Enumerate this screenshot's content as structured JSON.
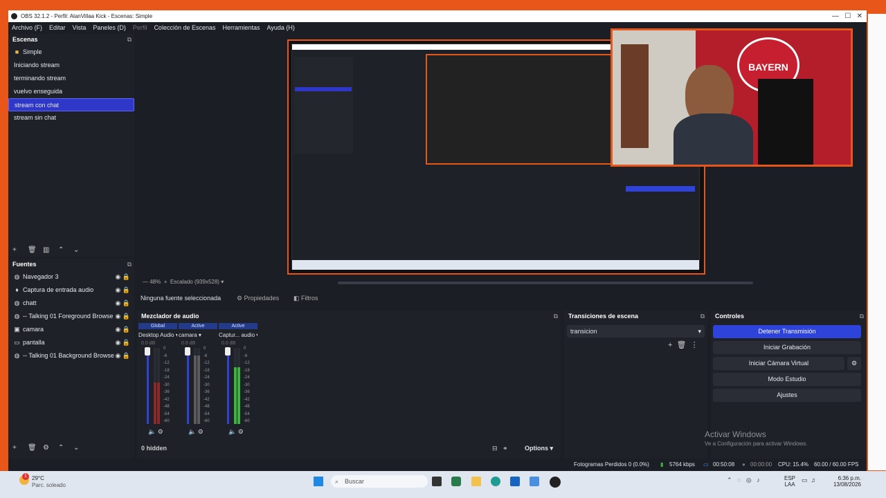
{
  "window": {
    "title": "OBS 32.1.2 - Perfil: AlanVillaa Kick - Escenas: Simple"
  },
  "menu": [
    "Archivo (F)",
    "Editar",
    "Vista",
    "Paneles (D)",
    "Perfil",
    "Colección de Escenas",
    "Herramientas",
    "Ayuda (H)"
  ],
  "scenes": {
    "title": "Escenas",
    "items": [
      "Simple",
      "Iniciando stream",
      "terminando stream",
      "vuelvo enseguida",
      "stream con chat",
      "stream sin chat"
    ]
  },
  "sources": {
    "title": "Fuentes",
    "items": [
      "Navegador 3",
      "Captura de entrada audio",
      "chatt",
      "-- Talking 01  Foreground Browse",
      "camara",
      "pantalla",
      "-- Talking 01  Background Browse"
    ]
  },
  "preview": {
    "zoom": "48%",
    "scaled": "Escalado (939x528)",
    "webcam_text": "BAYERN"
  },
  "source_toolbar": {
    "none": "Ninguna fuente seleccionada",
    "props": "Propiedades",
    "filters": "Filtros"
  },
  "mixer": {
    "title": "Mezclador de audio",
    "channels": [
      {
        "badge": "Global",
        "name": "Desktop Audio",
        "db": "0.0 dB",
        "level": 0.55,
        "color": "#8a2a2a"
      },
      {
        "badge": "Active",
        "name": "camara",
        "db": "0.0 dB",
        "level": 0.9,
        "color": "#5c5c5c"
      },
      {
        "badge": "Active",
        "name": "Captur... audio",
        "db": "0.0 dB",
        "level": 0.75,
        "color": "#3fb33f"
      }
    ],
    "scale": [
      "0",
      "-6",
      "-12",
      "-18",
      "-24",
      "-30",
      "-36",
      "-42",
      "-48",
      "-54",
      "-60"
    ],
    "hidden": "0 hidden",
    "options": "Options"
  },
  "transitions": {
    "title": "Transiciones de escena",
    "selected": "transicion"
  },
  "controls": {
    "title": "Controles",
    "stream": "Detener Transmisión",
    "record": "Iniciar Grabación",
    "virtualcam": "Iniciar Cámara Virtual",
    "studio": "Modo Estudio",
    "settings": "Ajustes"
  },
  "activate": {
    "line1": "Activar Windows",
    "line2": "Ve a Configuración para activar Windows."
  },
  "statusbar": {
    "dropped": "Fotogramas Perdidos 0 (0.0%)",
    "kbps": "5764 kbps",
    "stream_time": "00:50:08",
    "rec_time": "00:00:00",
    "cpu": "CPU: 15.4%",
    "fps": "60.00 / 60.00 FPS"
  },
  "taskbar": {
    "temp": "29°C",
    "weather": "Parc. soleado",
    "search": "Buscar",
    "lang1": "ESP",
    "lang2": "LAA",
    "time": "6:36 p.m.",
    "date": "13/08/2026",
    "badge": "1"
  },
  "colors": {
    "accent": "#2d43d9",
    "brand": "#e8561a"
  }
}
